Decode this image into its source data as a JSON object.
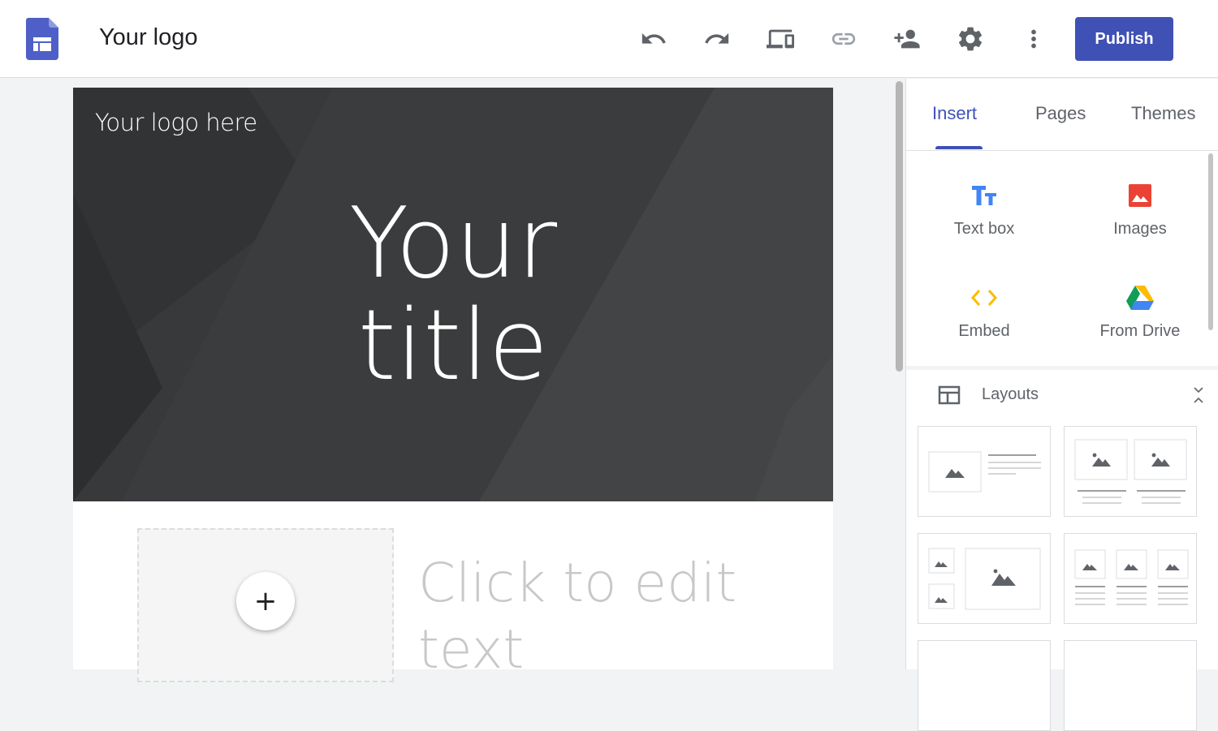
{
  "header": {
    "site_name": "Your logo",
    "publish_label": "Publish",
    "icons": [
      "sites-logo-icon",
      "undo-icon",
      "redo-icon",
      "preview-devices-icon",
      "link-icon",
      "share-icon",
      "settings-icon",
      "more-vert-icon"
    ]
  },
  "canvas": {
    "hero_logo_text": "Your logo here",
    "hero_title_line1": "Your",
    "hero_title_line2": "title",
    "body_text_line1": "Click to edit",
    "body_text_line2": "text",
    "add_button_symbol": "+"
  },
  "panel": {
    "tabs": [
      {
        "label": "Insert",
        "active": true
      },
      {
        "label": "Pages",
        "active": false
      },
      {
        "label": "Themes",
        "active": false
      }
    ],
    "insert_items": [
      {
        "label": "Text box",
        "icon": "text-box-icon"
      },
      {
        "label": "Images",
        "icon": "image-icon"
      },
      {
        "label": "Embed",
        "icon": "embed-icon"
      },
      {
        "label": "From Drive",
        "icon": "drive-icon"
      }
    ],
    "layouts_title": "Layouts"
  },
  "colors": {
    "accent": "#3f51b5",
    "hero_bg": "#38393b",
    "textbox_blue": "#4285f4",
    "image_red": "#ea4335",
    "embed_yellow": "#fbbc04"
  }
}
